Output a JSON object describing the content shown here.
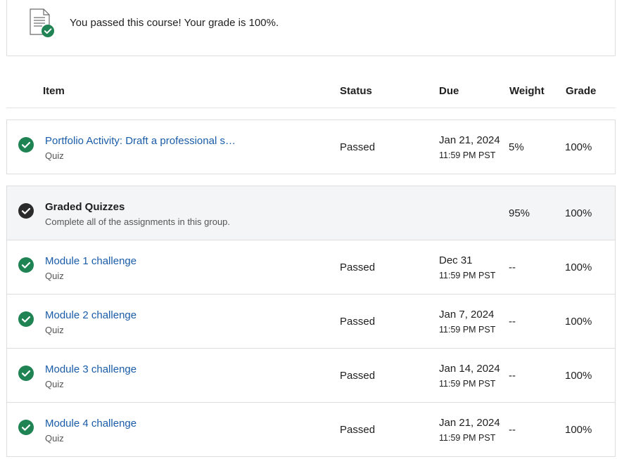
{
  "banner": {
    "message": "You passed this course! Your grade is 100%.",
    "icon": "document-check-icon"
  },
  "table_headers": {
    "item": "Item",
    "status": "Status",
    "due": "Due",
    "weight": "Weight",
    "grade": "Grade"
  },
  "portfolio": {
    "title": "Portfolio Activity: Draft a professional s…",
    "type": "Quiz",
    "status": "Passed",
    "due_date": "Jan 21, 2024",
    "due_time": "11:59 PM PST",
    "weight": "5%",
    "grade": "100%"
  },
  "group": {
    "title": "Graded Quizzes",
    "subtitle": "Complete all of the assignments in this group.",
    "weight": "95%",
    "grade": "100%"
  },
  "rows": [
    {
      "title": "Module 1 challenge",
      "type": "Quiz",
      "status": "Passed",
      "due_date": "Dec 31",
      "due_time": "11:59 PM PST",
      "weight": "--",
      "grade": "100%"
    },
    {
      "title": "Module 2 challenge",
      "type": "Quiz",
      "status": "Passed",
      "due_date": "Jan 7, 2024",
      "due_time": "11:59 PM PST",
      "weight": "--",
      "grade": "100%"
    },
    {
      "title": "Module 3 challenge",
      "type": "Quiz",
      "status": "Passed",
      "due_date": "Jan 14, 2024",
      "due_time": "11:59 PM PST",
      "weight": "--",
      "grade": "100%"
    },
    {
      "title": "Module 4 challenge",
      "type": "Quiz",
      "status": "Passed",
      "due_date": "Jan 21, 2024",
      "due_time": "11:59 PM PST",
      "weight": "--",
      "grade": "100%"
    }
  ],
  "colors": {
    "success_green": "#1f8354",
    "link_blue": "#1a5ca8",
    "group_bg": "#f4f5f6",
    "group_check": "#2b2b2b"
  }
}
